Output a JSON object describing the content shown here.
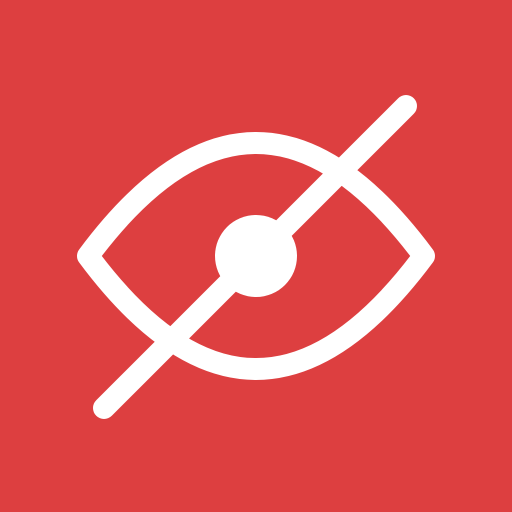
{
  "icon": {
    "name": "eye-off-icon",
    "background_color": "#DD3F40",
    "glyph_color": "#FFFFFF"
  }
}
